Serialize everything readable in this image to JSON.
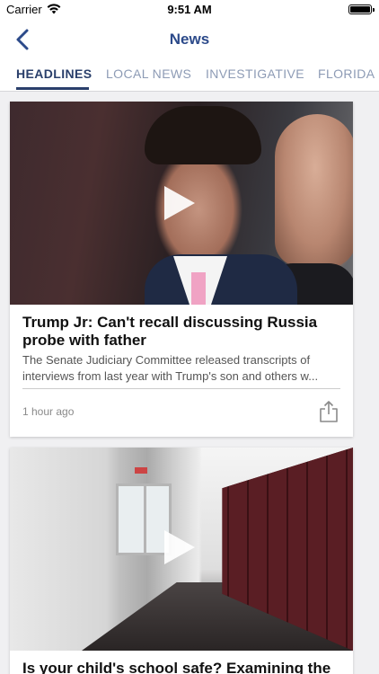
{
  "status_bar": {
    "carrier": "Carrier",
    "time": "9:51 AM"
  },
  "nav": {
    "title": "News",
    "back_icon": "chevron-left-icon"
  },
  "tabs": [
    {
      "label": "HEADLINES",
      "active": true
    },
    {
      "label": "LOCAL NEWS",
      "active": false
    },
    {
      "label": "INVESTIGATIVE",
      "active": false
    },
    {
      "label": "FLORIDA",
      "active": false
    }
  ],
  "articles": [
    {
      "headline": "Trump Jr: Can't recall discussing Russia probe with father",
      "summary": "The Senate Judiciary Committee released transcripts of interviews from last year with Trump's son and others w...",
      "timestamp": "1 hour ago",
      "has_video": true
    },
    {
      "headline": "Is your child's school safe? Examining the",
      "has_video": true
    }
  ],
  "colors": {
    "accent": "#2c4a8a",
    "tab_active": "#2a3f6b",
    "tab_inactive": "#8d9bb5"
  }
}
